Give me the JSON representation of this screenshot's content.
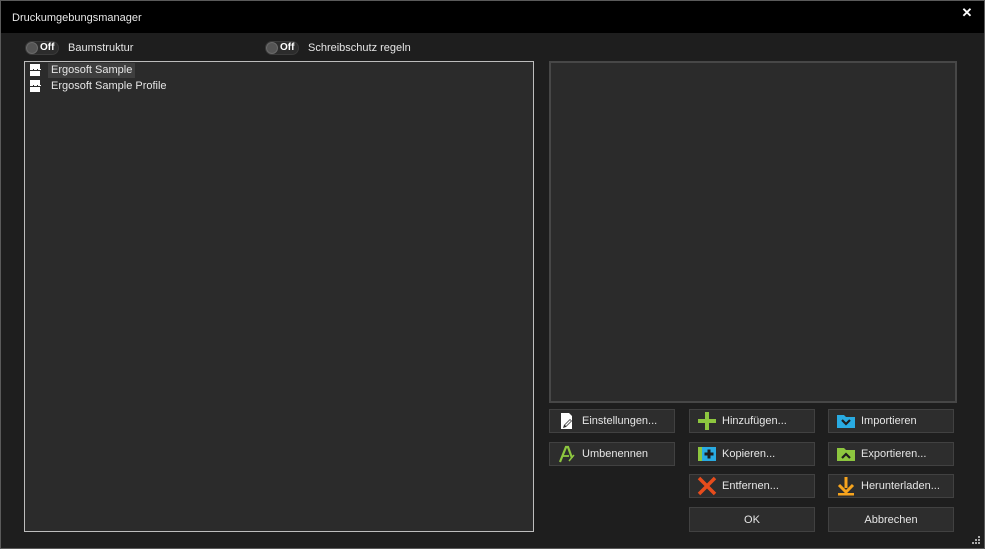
{
  "window": {
    "title": "Druckumgebungsmanager",
    "close_symbol": "✕"
  },
  "toggles": {
    "tree": {
      "state": "Off",
      "label": "Baumstruktur"
    },
    "readonly": {
      "state": "Off",
      "label": "Schreibschutz regeln"
    }
  },
  "tree": {
    "items": [
      {
        "label": "Ergosoft Sample",
        "icon": "document-icon",
        "selected": true
      },
      {
        "label": "Ergosoft Sample Profile",
        "icon": "document-icon",
        "selected": false
      }
    ]
  },
  "buttons": {
    "einstellungen": {
      "label": "Einstellungen...",
      "icon": "edit-document-icon"
    },
    "umbenennen": {
      "label": "Umbenennen",
      "icon": "rename-icon"
    },
    "hinzufuegen": {
      "label": "Hinzufügen...",
      "icon": "plus-icon"
    },
    "kopieren": {
      "label": "Kopieren...",
      "icon": "copy-icon"
    },
    "entfernen": {
      "label": "Entfernen...",
      "icon": "remove-x-icon"
    },
    "importieren": {
      "label": "Importieren",
      "icon": "folder-import-icon"
    },
    "exportieren": {
      "label": "Exportieren...",
      "icon": "folder-export-icon"
    },
    "herunterladen": {
      "label": "Herunterladen...",
      "icon": "download-arrow-icon"
    },
    "ok": {
      "label": "OK"
    },
    "abbrechen": {
      "label": "Abbrechen"
    }
  },
  "colors": {
    "green": "#8dc63f",
    "cyan": "#29abe2",
    "red": "#e84c1c",
    "orange": "#f7a41d"
  }
}
